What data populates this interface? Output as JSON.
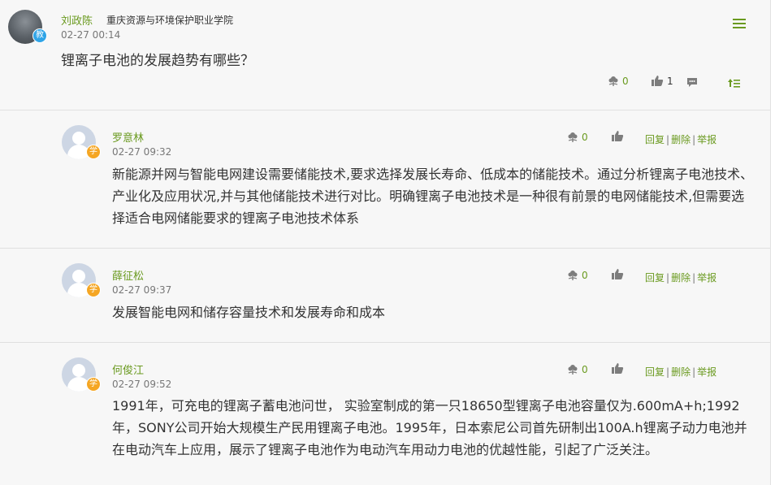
{
  "post": {
    "author": "刘政陈",
    "author_badge": "教",
    "school": "重庆资源与环境保护职业学院",
    "time": "02-27 00:14",
    "title": "锂离子电池的发展趋势有哪些？",
    "flower_count": "0",
    "like_count": "1"
  },
  "replies": [
    {
      "author": "罗意林",
      "badge": "学",
      "time": "02-27 09:32",
      "flower_count": "0",
      "text": "新能源并网与智能电网建设需要储能技术,要求选择发展长寿命、低成本的储能技术。通过分析锂离子电池技术、产业化及应用状况,并与其他储能技术进行对比。明确锂离子电池技术是一种很有前景的电网储能技术,但需要选择适合电网储能要求的锂离子电池技术体系"
    },
    {
      "author": "薛征松",
      "badge": "学",
      "time": "02-27 09:37",
      "flower_count": "0",
      "text": "发展智能电网和储存容量技术和发展寿命和成本"
    },
    {
      "author": "何俊江",
      "badge": "学",
      "time": "02-27 09:52",
      "flower_count": "0",
      "text": "1991年，可充电的锂离子蓄电池问世，  实验室制成的第一只18650型锂离子电池容量仅为.600mA+h;1992年，SONY公司开始大规模生产民用锂离子电池。1995年，日本索尼公司首先研制出100A.h锂离子动力电池并在电动汽车上应用，展示了锂离子电池作为电动汽车用动力电池的优越性能，引起了广泛关注。"
    }
  ],
  "actions": {
    "reply": "回复",
    "delete": "删除",
    "report": "举报",
    "separator": "|"
  },
  "colors": {
    "accent": "#6a9a1f",
    "teacher_badge": "#2fa4e7",
    "student_badge": "#f5a623"
  }
}
